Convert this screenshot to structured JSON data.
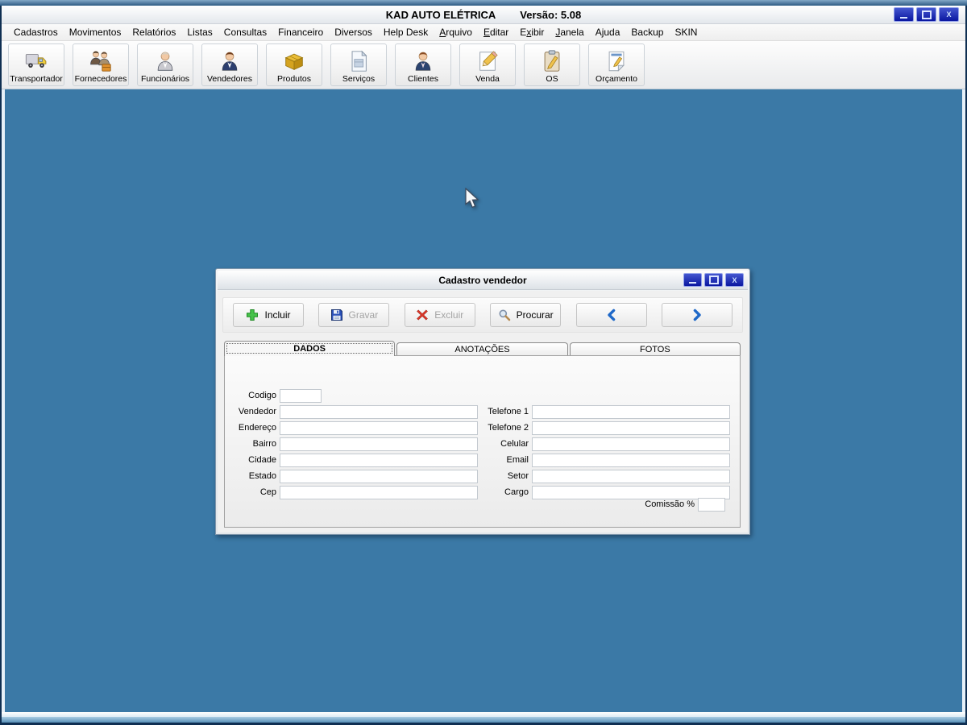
{
  "titlebar": {
    "title": "KAD AUTO ELÉTRICA",
    "version": "Versão: 5.08"
  },
  "window_controls": {
    "minimize": "minimize",
    "maximize": "maximize",
    "close": "X"
  },
  "menu": {
    "items": [
      {
        "label": "Cadastros"
      },
      {
        "label": "Movimentos"
      },
      {
        "label": "Relatórios"
      },
      {
        "label": "Listas"
      },
      {
        "label": "Consultas"
      },
      {
        "label": "Financeiro"
      },
      {
        "label": "Diversos"
      },
      {
        "label": "Help Desk"
      },
      {
        "label": "Arquivo",
        "hotkey_index": 0
      },
      {
        "label": "Editar",
        "hotkey_index": 0
      },
      {
        "label": "Exibir",
        "hotkey_index": 1
      },
      {
        "label": "Janela",
        "hotkey_index": 0
      },
      {
        "label": "Ajuda"
      },
      {
        "label": "Backup"
      },
      {
        "label": "SKIN"
      }
    ]
  },
  "toolbar": {
    "buttons": [
      {
        "label": "Transportador",
        "icon": "truck-icon"
      },
      {
        "label": "Fornecedores",
        "icon": "suppliers-icon"
      },
      {
        "label": "Funcionários",
        "icon": "employee-icon"
      },
      {
        "label": "Vendedores",
        "icon": "vendor-icon"
      },
      {
        "label": "Produtos",
        "icon": "products-box-icon"
      },
      {
        "label": "Serviços",
        "icon": "services-document-icon"
      },
      {
        "label": "Clientes",
        "icon": "client-icon"
      },
      {
        "label": "Venda",
        "icon": "sale-pencil-icon"
      },
      {
        "label": "OS",
        "icon": "work-order-clipboard-icon"
      },
      {
        "label": "Orçamento",
        "icon": "budget-note-icon"
      }
    ]
  },
  "dialog": {
    "title": "Cadastro vendedor",
    "actions": [
      {
        "label": "Incluir",
        "icon": "plus-icon",
        "enabled": true,
        "name": "incluir-button"
      },
      {
        "label": "Gravar",
        "icon": "save-floppy-icon",
        "enabled": false,
        "name": "gravar-button"
      },
      {
        "label": "Excluir",
        "icon": "delete-x-icon",
        "enabled": false,
        "name": "excluir-button"
      },
      {
        "label": "Procurar",
        "icon": "search-icon",
        "enabled": true,
        "name": "procurar-button"
      },
      {
        "label": "",
        "icon": "chevron-left-icon",
        "enabled": true,
        "name": "previous-record-button"
      },
      {
        "label": "",
        "icon": "chevron-right-icon",
        "enabled": true,
        "name": "next-record-button"
      }
    ],
    "tabs": [
      {
        "label": "DADOS",
        "active": true
      },
      {
        "label": "ANOTAÇÕES",
        "active": false
      },
      {
        "label": "FOTOS",
        "active": false
      }
    ],
    "form": {
      "left_fields": [
        {
          "label": "Codigo",
          "value": "",
          "size": "small"
        },
        {
          "label": "Vendedor",
          "value": ""
        },
        {
          "label": "Endereço",
          "value": ""
        },
        {
          "label": "Bairro",
          "value": ""
        },
        {
          "label": "Cidade",
          "value": ""
        },
        {
          "label": "Estado",
          "value": ""
        },
        {
          "label": "Cep",
          "value": ""
        }
      ],
      "right_fields": [
        {
          "label": "Telefone 1",
          "value": ""
        },
        {
          "label": "Telefone 2",
          "value": ""
        },
        {
          "label": "Celular",
          "value": ""
        },
        {
          "label": "Email",
          "value": ""
        },
        {
          "label": "Setor",
          "value": ""
        },
        {
          "label": "Cargo",
          "value": ""
        }
      ],
      "commission": {
        "label": "Comissão %",
        "value": ""
      }
    }
  },
  "colors": {
    "desktop_blue": "#3b79a6",
    "control_button_navy": "#0a17a0",
    "frame_navy": "#0f2f52",
    "accent_blue": "#1e68c8",
    "disabled_text": "#a3a3a3"
  }
}
